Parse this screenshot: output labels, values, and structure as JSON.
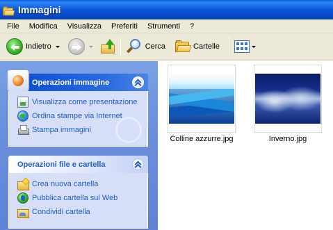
{
  "window": {
    "title": "Immagini"
  },
  "menu": [
    "File",
    "Modifica",
    "Visualizza",
    "Preferiti",
    "Strumenti",
    "?"
  ],
  "toolbar": {
    "back_label": "Indietro",
    "search_label": "Cerca",
    "folders_label": "Cartelle"
  },
  "taskpane": {
    "image_tasks": {
      "title": "Operazioni immagine",
      "items": [
        {
          "label": "Visualizza come presentazione",
          "icon": "slideshow-icon"
        },
        {
          "label": "Ordina stampe via Internet",
          "icon": "globe-icon"
        },
        {
          "label": "Stampa immagini",
          "icon": "printer-icon"
        }
      ]
    },
    "file_tasks": {
      "title": "Operazioni file e cartella",
      "items": [
        {
          "label": "Crea nuova cartella",
          "icon": "new-folder-icon"
        },
        {
          "label": "Pubblica cartella sul Web",
          "icon": "publish-web-icon"
        },
        {
          "label": "Condividi cartella",
          "icon": "share-folder-icon"
        }
      ]
    }
  },
  "files": [
    {
      "name": "Colline azzurre.jpg",
      "thumbnail": "blue-hills"
    },
    {
      "name": "Inverno.jpg",
      "thumbnail": "winter"
    }
  ],
  "colors": {
    "titlebar": "#0a56d8",
    "taskpane_bg": "#6b8fdc",
    "link": "#215dc6",
    "chrome": "#ece9d8"
  }
}
